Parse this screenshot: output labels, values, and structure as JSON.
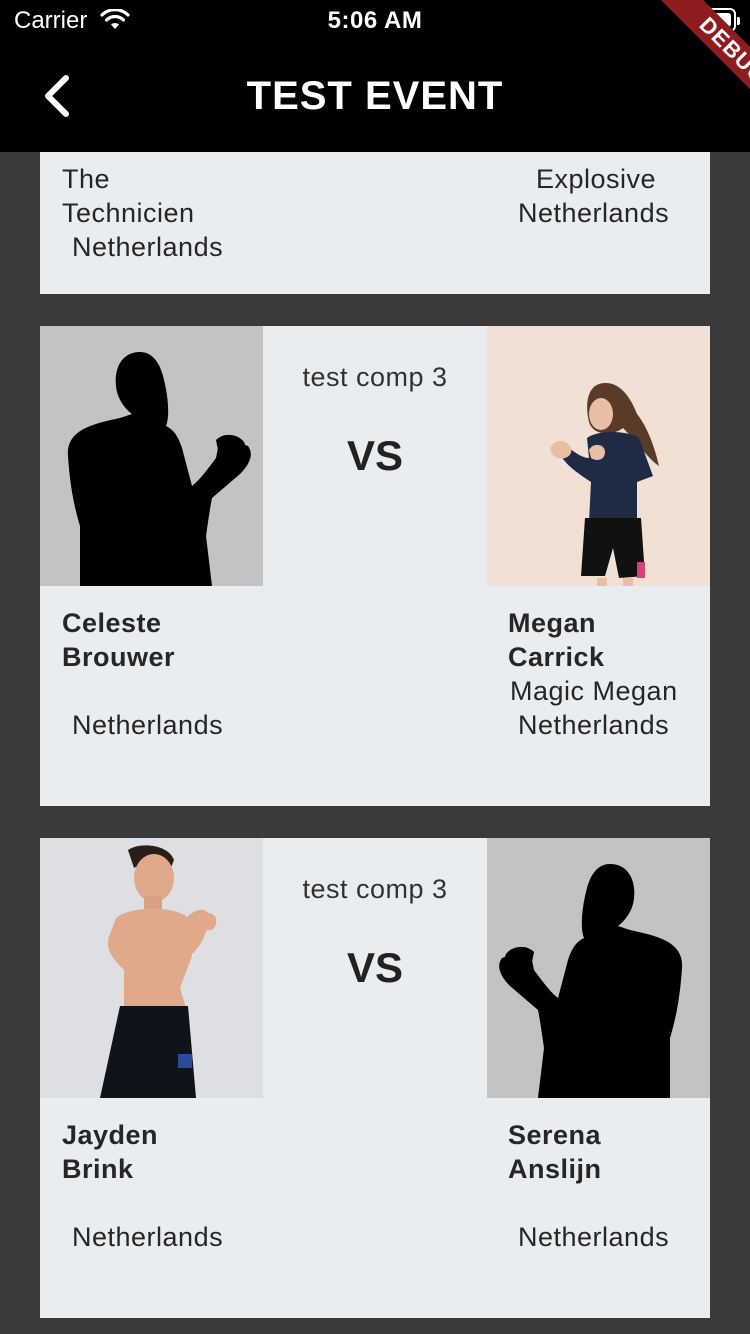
{
  "status_bar": {
    "carrier": "Carrier",
    "time": "5:06 AM"
  },
  "app_bar": {
    "title": "TEST EVENT",
    "debug_banner": "DEBUG"
  },
  "cards": [
    {
      "left": {
        "name": "",
        "nickname_lines": [
          "The",
          "Technicien"
        ],
        "country": "Netherlands"
      },
      "right": {
        "name": "",
        "nickname_lines": [
          "Explosive"
        ],
        "country": "Netherlands"
      }
    },
    {
      "competition": "test comp 3",
      "vs": "VS",
      "left": {
        "name_lines": [
          "Celeste",
          "Brouwer"
        ],
        "nickname": "",
        "country": "Netherlands"
      },
      "right": {
        "name_lines": [
          "Megan",
          "Carrick"
        ],
        "nickname": "Magic Megan",
        "country": "Netherlands"
      }
    },
    {
      "competition": "test comp 3",
      "vs": "VS",
      "left": {
        "name_lines": [
          "Jayden",
          "Brink"
        ],
        "nickname": "",
        "country": "Netherlands"
      },
      "right": {
        "name_lines": [
          "Serena",
          "Anslijn"
        ],
        "nickname": "",
        "country": "Netherlands"
      }
    }
  ]
}
